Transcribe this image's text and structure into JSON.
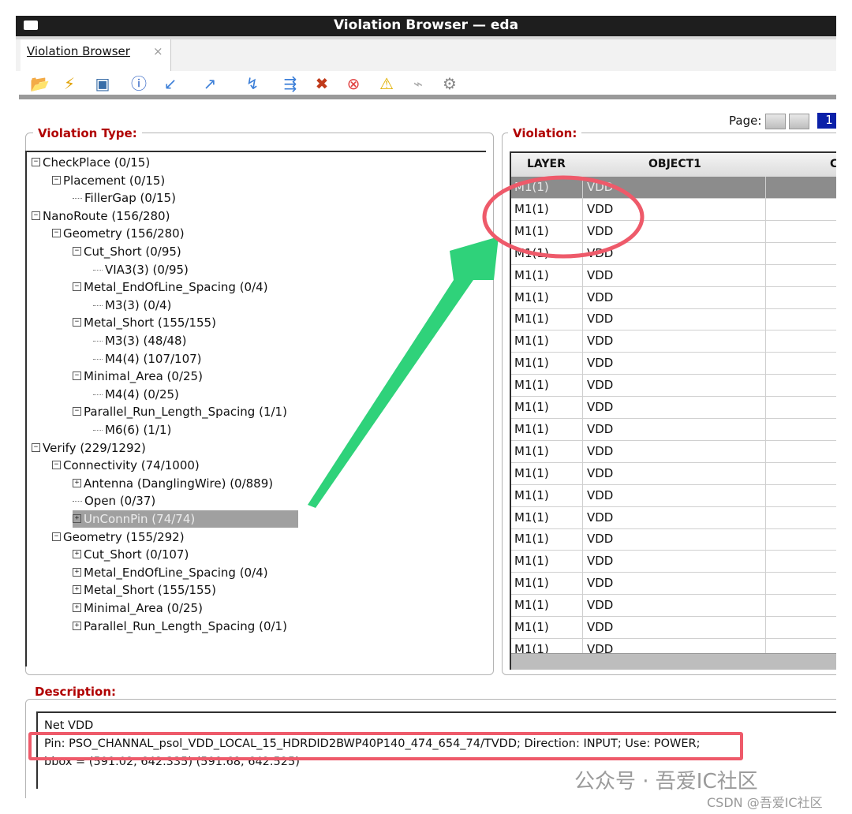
{
  "window": {
    "title": "Violation Browser — eda"
  },
  "tab": {
    "label": "Violation Browser",
    "close": "×"
  },
  "toolbar": {
    "icons": [
      "open-folder-icon",
      "highlight-violation-icon",
      "zoom-fit-icon",
      "info-icon",
      "prev-violation-icon",
      "next-violation-icon",
      "delete-violation-icon",
      "multi-select-icon",
      "clear-icon",
      "stop-icon",
      "warning-icon",
      "plug-icon",
      "settings-gear-icon"
    ]
  },
  "pager": {
    "label": "Page:",
    "current": "1"
  },
  "violation_type": {
    "legend": "Violation Type:",
    "tree": [
      {
        "label": "CheckPlace (0/15)",
        "level": 0,
        "type": "minus"
      },
      {
        "label": "Placement (0/15)",
        "level": 1,
        "type": "minus"
      },
      {
        "label": "FillerGap (0/15)",
        "level": 2,
        "type": "leaf"
      },
      {
        "label": "NanoRoute (156/280)",
        "level": 0,
        "type": "minus"
      },
      {
        "label": "Geometry (156/280)",
        "level": 1,
        "type": "minus"
      },
      {
        "label": "Cut_Short (0/95)",
        "level": 2,
        "type": "minus"
      },
      {
        "label": "VIA3(3) (0/95)",
        "level": 3,
        "type": "leaf"
      },
      {
        "label": "Metal_EndOfLine_Spacing (0/4)",
        "level": 2,
        "type": "minus"
      },
      {
        "label": "M3(3) (0/4)",
        "level": 3,
        "type": "leaf"
      },
      {
        "label": "Metal_Short (155/155)",
        "level": 2,
        "type": "minus"
      },
      {
        "label": "M3(3) (48/48)",
        "level": 3,
        "type": "leaf"
      },
      {
        "label": "M4(4) (107/107)",
        "level": 3,
        "type": "leaf"
      },
      {
        "label": "Minimal_Area (0/25)",
        "level": 2,
        "type": "minus"
      },
      {
        "label": "M4(4) (0/25)",
        "level": 3,
        "type": "leaf"
      },
      {
        "label": "Parallel_Run_Length_Spacing (1/1)",
        "level": 2,
        "type": "minus"
      },
      {
        "label": "M6(6) (1/1)",
        "level": 3,
        "type": "leaf"
      },
      {
        "label": "Verify (229/1292)",
        "level": 0,
        "type": "minus"
      },
      {
        "label": "Connectivity (74/1000)",
        "level": 1,
        "type": "minus"
      },
      {
        "label": "Antenna (DanglingWire) (0/889)",
        "level": 2,
        "type": "plus"
      },
      {
        "label": "Open (0/37)",
        "level": 2,
        "type": "leaf"
      },
      {
        "label": "UnConnPin (74/74)",
        "level": 2,
        "type": "plus",
        "selected": true
      },
      {
        "label": "Geometry (155/292)",
        "level": 1,
        "type": "minus"
      },
      {
        "label": "Cut_Short (0/107)",
        "level": 2,
        "type": "plus"
      },
      {
        "label": "Metal_EndOfLine_Spacing (0/4)",
        "level": 2,
        "type": "plus"
      },
      {
        "label": "Metal_Short (155/155)",
        "level": 2,
        "type": "plus"
      },
      {
        "label": "Minimal_Area (0/25)",
        "level": 2,
        "type": "plus"
      },
      {
        "label": "Parallel_Run_Length_Spacing (0/1)",
        "level": 2,
        "type": "plus"
      }
    ]
  },
  "violation": {
    "legend": "Violation:",
    "columns": [
      "LAYER",
      "OBJECT1",
      "C"
    ],
    "rows": [
      [
        "M1(1)",
        "VDD"
      ],
      [
        "M1(1)",
        "VDD"
      ],
      [
        "M1(1)",
        "VDD"
      ],
      [
        "M1(1)",
        "VDD"
      ],
      [
        "M1(1)",
        "VDD"
      ],
      [
        "M1(1)",
        "VDD"
      ],
      [
        "M1(1)",
        "VDD"
      ],
      [
        "M1(1)",
        "VDD"
      ],
      [
        "M1(1)",
        "VDD"
      ],
      [
        "M1(1)",
        "VDD"
      ],
      [
        "M1(1)",
        "VDD"
      ],
      [
        "M1(1)",
        "VDD"
      ],
      [
        "M1(1)",
        "VDD"
      ],
      [
        "M1(1)",
        "VDD"
      ],
      [
        "M1(1)",
        "VDD"
      ],
      [
        "M1(1)",
        "VDD"
      ],
      [
        "M1(1)",
        "VDD"
      ],
      [
        "M1(1)",
        "VDD"
      ],
      [
        "M1(1)",
        "VDD"
      ],
      [
        "M1(1)",
        "VDD"
      ],
      [
        "M1(1)",
        "VDD"
      ],
      [
        "M1(1)",
        "VDD"
      ]
    ]
  },
  "description": {
    "legend": "Description:",
    "lines": [
      "Net VDD",
      "Pin: PSO_CHANNAL_psol_VDD_LOCAL_15_HDRDID2BWP40P140_474_654_74/TVDD; Direction: INPUT; Use: POWER;",
      "bbox = (591.02, 642.335) (591.68, 642.525)"
    ]
  },
  "watermark": {
    "main": "公众号 · 吾爱IC社区",
    "sub": "CSDN @吾爱IC社区"
  },
  "colors": {
    "legend": "#b00000",
    "annotation_red": "#ee5a6a",
    "annotation_green": "#2fd27a",
    "page_blue": "#0a20a8"
  }
}
